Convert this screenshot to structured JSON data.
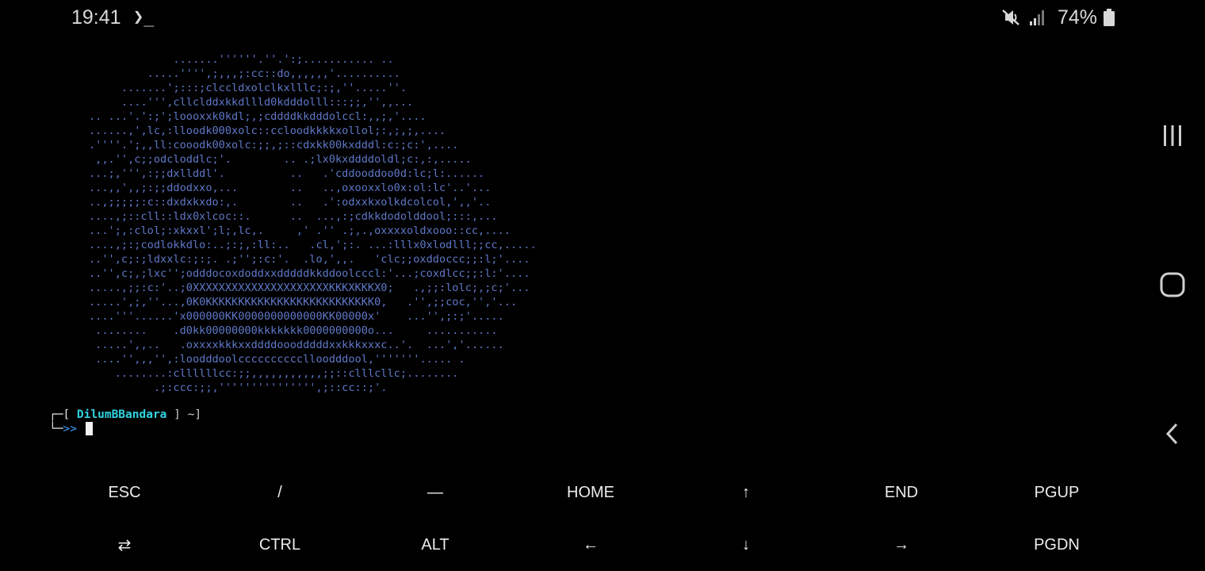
{
  "status_bar": {
    "time": "19:41",
    "terminal_indicator": "❯_",
    "battery_percent": "74%",
    "icons": [
      "mute-vibrate-icon",
      "signal-icon",
      "battery-icon"
    ]
  },
  "terminal": {
    "ascii_art": "             .......''''''.''.':;........... ..\n         .....'''',;,,,;:cc::do,,,,,,'..........\n     .......';:::;clccldxolclkxlllc;:;,''.....''.\n     ....''',cllclddxkkdllld0kdddolll:::;;,'',,...\n.. ...'.':;';loooxxk0kdl;,;cddddkkdddolccl:,,;,'....\n......,',lc,:lloodk000xolc::ccloodkkkkxollol;:,;,;,....\n.''''.';,,ll:cooodk00xolc:;;,;::cdxkk00kxdddl:c:;c:',....\n ,,.'',c;;odcloddlc;'.        .. .;lx0kxddddoldl;c:,:,.....\n...;,''',:;;dxllddl'.          ..   .'cddooddoo0d:lc;l:......\n...,,',,;:;;ddodxxo,...        ..   ..,oxooxxlo0x:ol:lc'..'...\n..,;;;;;:c::dxdxkxdo:,.        ..   .':odxxkxolkdcolcol,',,'..\n....,;::cll::ldx0xlcoc::.      ..  ...,:;cdkkdodolddool;:::,...\n...';,:clol;:xkxxl';l;,lc,.     ,' .'' .;,.,oxxxxoldxooo::cc,....\n....,;:;codlokkdlo:..;:;,:ll:..   .cl,';:. ...:lllx0xlodlll;;cc,.....\n..'',c;:;ldxxlc:;:;. .;'';:c:'.  .lo,',,.   'clc;;oxddoccc;;:l;'....\n..'',c;,;lxc'';odddocoxdoddxxdddddkkddoolcccl:'...;coxdlcc;;:l:'....\n.....,;;:c:'..;0XXXXXXXXXXXXXXXXXXXXXKKKXKKKX0;   .,;;:lolc;,;c;'...\n.....',;,''...,0K0KKKKKKKKKKKKKKKKKKKKKKKKKK0,   .'',;;coc,'','...\n....'''......'x000000KK0000000000000KK00000x'    ...'',;:;'.....\n ........    .d0kk00000000kkkkkkk0000000000o...     ...........\n .....',,..   .oxxxxkkkxxddddooodddddxxkkkxxxc..'.  ...','......\n ....'',,,'',:loodddoolcccccccccclloodddool,'''''''..... .\n    ........:cllllllcc:;;,,,,,,,,,,,;;::clllcllc;........\n          .;:ccc:;;,''''''''''''''',;::cc::;'.",
    "prompt_open": "┌─[ ",
    "username": "DilumBBandara",
    "prompt_close": " ] ~]",
    "prompt_arrow_prefix": "└─",
    "prompt_arrow": ">>",
    "input": ""
  },
  "nav": {
    "icons": [
      "recent-apps-icon",
      "home-icon",
      "back-icon"
    ]
  },
  "extra_keys": {
    "row1": [
      "ESC",
      "/",
      "—",
      "HOME",
      "↑",
      "END",
      "PGUP"
    ],
    "row2": [
      "⇄",
      "CTRL",
      "ALT",
      "←",
      "↓",
      "→",
      "PGDN"
    ]
  }
}
